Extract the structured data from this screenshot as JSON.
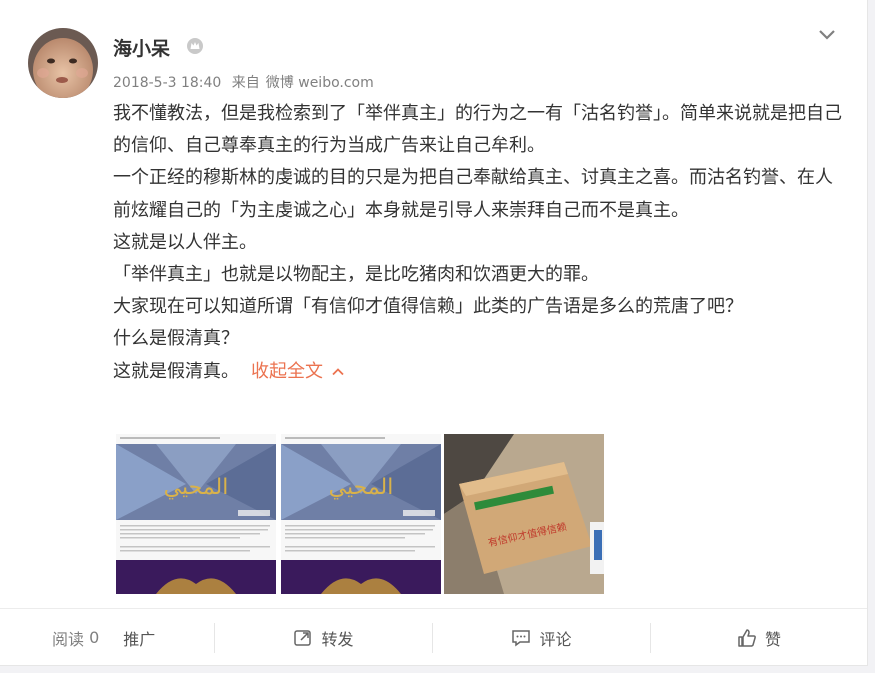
{
  "post": {
    "author": "海小呆",
    "time": "2018-5-3 18:40",
    "source_prefix": "来自",
    "source": "微博 weibo.com",
    "paragraphs": [
      "我不懂教法，但是我检索到了「举伴真主」的行为之一有「沽名钓誉」。简单来说就是把自己的信仰、自己尊奉真主的行为当成广告来让自己牟利。",
      "一个正经的穆斯林的虔诚的目的只是为把自己奉献给真主、讨真主之喜。而沽名钓誉、在人前炫耀自己的「为主虔诚之心」本身就是引导人来崇拜自己而不是真主。",
      "这就是以人伴主。",
      "「举伴真主」也就是以物配主，是比吃猪肉和饮酒更大的罪。",
      "大家现在可以知道所谓「有信仰才值得信赖」此类的广告语是多么的荒唐了吧？",
      "什么是假清真？",
      "这就是假清真。"
    ],
    "collapse_label": "收起全文",
    "thumb_calligraphy": "المحيي",
    "box_label": "有信仰才值得信赖"
  },
  "footer": {
    "reads_label": "阅读",
    "reads_count": "0",
    "promote": "推广",
    "repost": "转发",
    "comment": "评论",
    "like": "赞"
  },
  "colors": {
    "accent": "#eb7350",
    "text": "#333333",
    "meta": "#808080"
  }
}
